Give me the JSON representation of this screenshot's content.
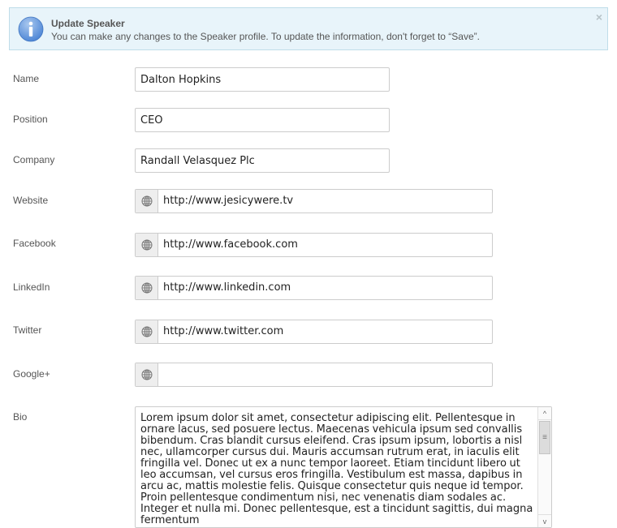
{
  "alert": {
    "icon": "info-icon",
    "title": "Update Speaker",
    "message": "You can make any changes to the Speaker profile. To update the information, don't forget to “Save”.",
    "close_glyph": "×"
  },
  "form": {
    "name": {
      "label": "Name",
      "value": "Dalton Hopkins"
    },
    "position": {
      "label": "Position",
      "value": "CEO"
    },
    "company": {
      "label": "Company",
      "value": "Randall Velasquez Plc"
    },
    "website": {
      "label": "Website",
      "value": "http://www.jesicywere.tv",
      "icon": "globe-icon"
    },
    "facebook": {
      "label": "Facebook",
      "value": "http://www.facebook.com",
      "icon": "globe-icon"
    },
    "linkedin": {
      "label": "LinkedIn",
      "value": "http://www.linkedin.com",
      "icon": "globe-icon"
    },
    "twitter": {
      "label": "Twitter",
      "value": "http://www.twitter.com",
      "icon": "globe-icon"
    },
    "googleplus": {
      "label": "Google+",
      "value": "",
      "icon": "globe-icon"
    },
    "bio": {
      "label": "Bio",
      "value": "Lorem ipsum dolor sit amet, consectetur adipiscing elit. Pellentesque in ornare lacus, sed posuere lectus. Maecenas vehicula ipsum sed convallis bibendum. Cras blandit cursus eleifend. Cras ipsum ipsum, lobortis a nisl nec, ullamcorper cursus dui. Mauris accumsan rutrum erat, in iaculis elit fringilla vel. Donec ut ex a nunc tempor laoreet. Etiam tincidunt libero ut leo accumsan, vel cursus eros fringilla. Vestibulum est massa, dapibus in arcu ac, mattis molestie felis. Quisque consectetur quis neque id tempor. Proin pellentesque condimentum nisi, nec venenatis diam sodales ac. Integer et nulla mi. Donec pellentesque, est a tincidunt sagittis, dui magna fermentum"
    }
  },
  "scrollbar": {
    "up_glyph": "^",
    "down_glyph": "v",
    "thumb_glyph": "≡"
  }
}
